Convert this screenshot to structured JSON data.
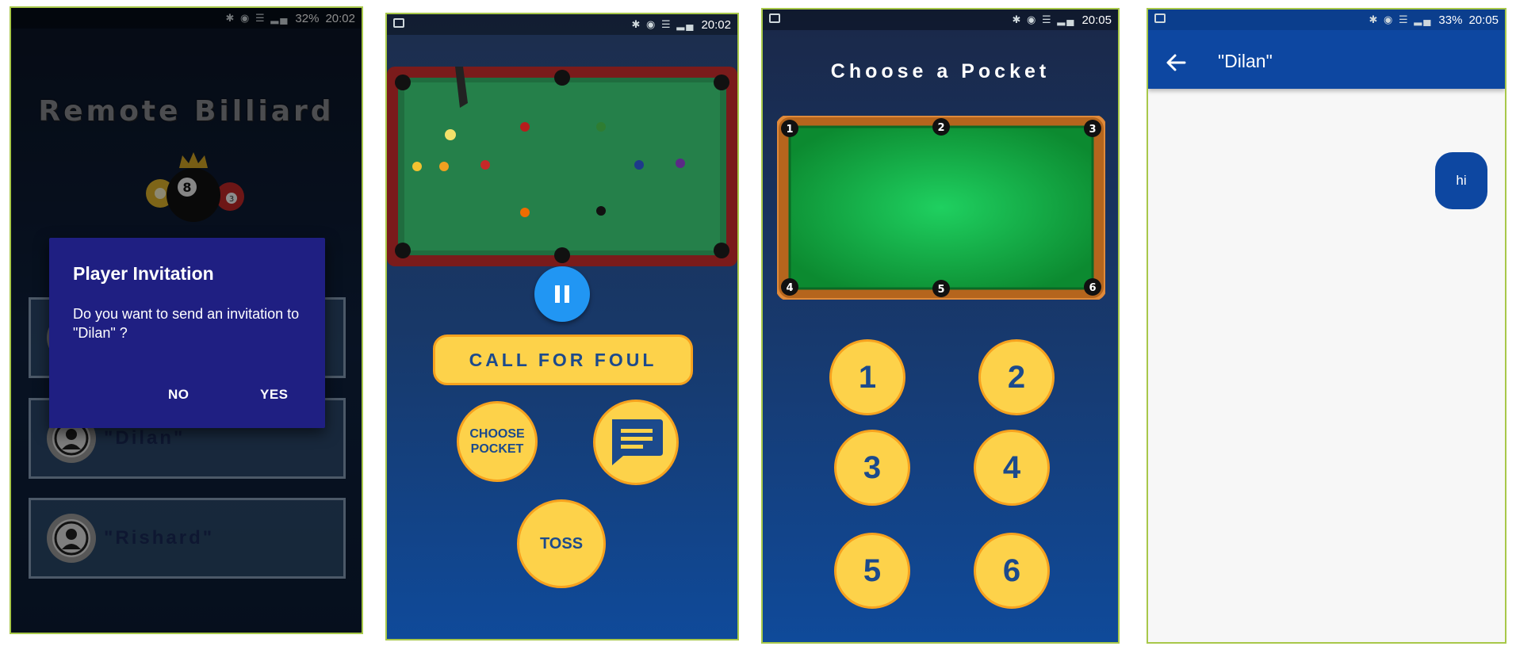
{
  "colors": {
    "accent_yellow": "#fdd24a",
    "accent_orange": "#f7a21e",
    "dialog_bg": "#1f1f82",
    "brand_blue": "#0d47a1",
    "pause_blue": "#2196f3"
  },
  "screen1": {
    "status": {
      "battery": "32%",
      "time": "20:02"
    },
    "app_title": "Remote Billiard",
    "players": [
      {
        "name": "\"Dilan\""
      },
      {
        "name": "\"Rishard\""
      }
    ],
    "dialog": {
      "title": "Player Invitation",
      "message": "Do you want to send an invitation to \"Dilan\" ?",
      "no_label": "NO",
      "yes_label": "YES"
    }
  },
  "screen2": {
    "status": {
      "time": "20:02"
    },
    "pause_icon": "pause-icon",
    "call_for_foul_label": "CALL FOR FOUL",
    "choose_pocket_label": "CHOOSE POCKET",
    "chat_icon": "chat-icon",
    "toss_label": "TOSS"
  },
  "screen3": {
    "status": {
      "time": "20:05"
    },
    "title": "Choose a Pocket",
    "pocket_markers": [
      "1",
      "2",
      "3",
      "4",
      "5",
      "6"
    ],
    "pocket_buttons": [
      "1",
      "2",
      "3",
      "4",
      "5",
      "6"
    ]
  },
  "screen4": {
    "status": {
      "battery": "33%",
      "time": "20:05"
    },
    "chat_title": "\"Dilan\"",
    "messages": [
      {
        "text": "hi",
        "from": "me"
      }
    ]
  }
}
